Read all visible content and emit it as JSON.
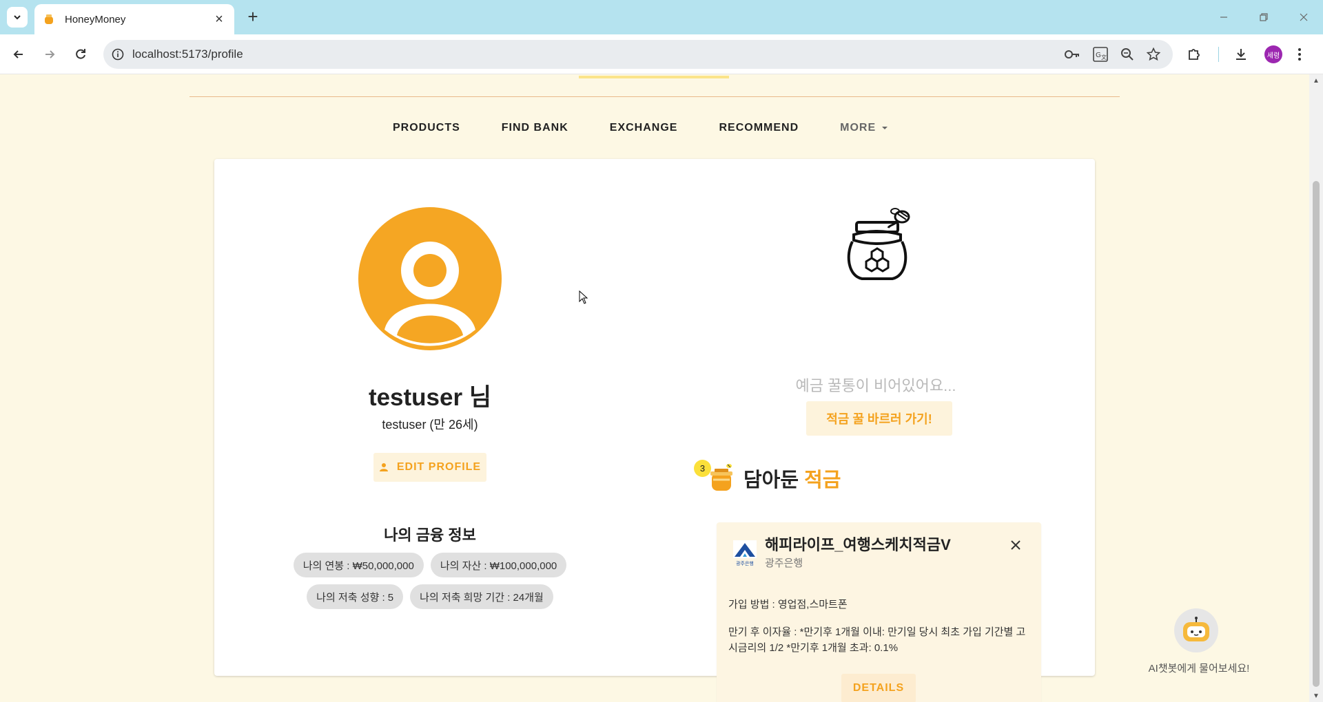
{
  "browser": {
    "tab_title": "HoneyMoney",
    "url": "localhost:5173/profile",
    "profile_initials": "세령"
  },
  "nav": {
    "items": [
      "PRODUCTS",
      "FIND BANK",
      "EXCHANGE",
      "RECOMMEND"
    ],
    "more_label": "MORE"
  },
  "profile": {
    "display_name": "testuser 님",
    "subtitle": "testuser (만 26세)",
    "edit_label": "EDIT PROFILE",
    "finance_title": "나의 금융 정보",
    "chips": [
      "나의 연봉 : ₩50,000,000",
      "나의 자산 : ₩100,000,000",
      "나의 저축 성향 : 5",
      "나의 저축 희망 기간 : 24개월"
    ]
  },
  "deposit": {
    "empty_message": "예금 꿀통이 비어있어요...",
    "go_button": "적금 꿀 바르러 가기!"
  },
  "saved": {
    "count": "3",
    "title_main": "담아둔",
    "title_accent": "적금",
    "product": {
      "name": "해피라이프_여행스케치적금V",
      "bank": "광주은행",
      "join_method": "가입 방법 : 영업점,스마트폰",
      "after_rate": "만기 후 이자율 : *만기후 1개월 이내: 만기일 당시 최초 가입 기간별 고시금리의 1/2 *만기후 1개월 초과: 0.1%",
      "details_label": "DETAILS",
      "bank_logo_text": "광주은행"
    }
  },
  "chatbot": {
    "label": "AI챗봇에게 물어보세요!"
  },
  "colors": {
    "accent": "#f4a21e",
    "page_bg": "#fdf8e4",
    "chrome_tabbar": "#b5e3ef"
  }
}
